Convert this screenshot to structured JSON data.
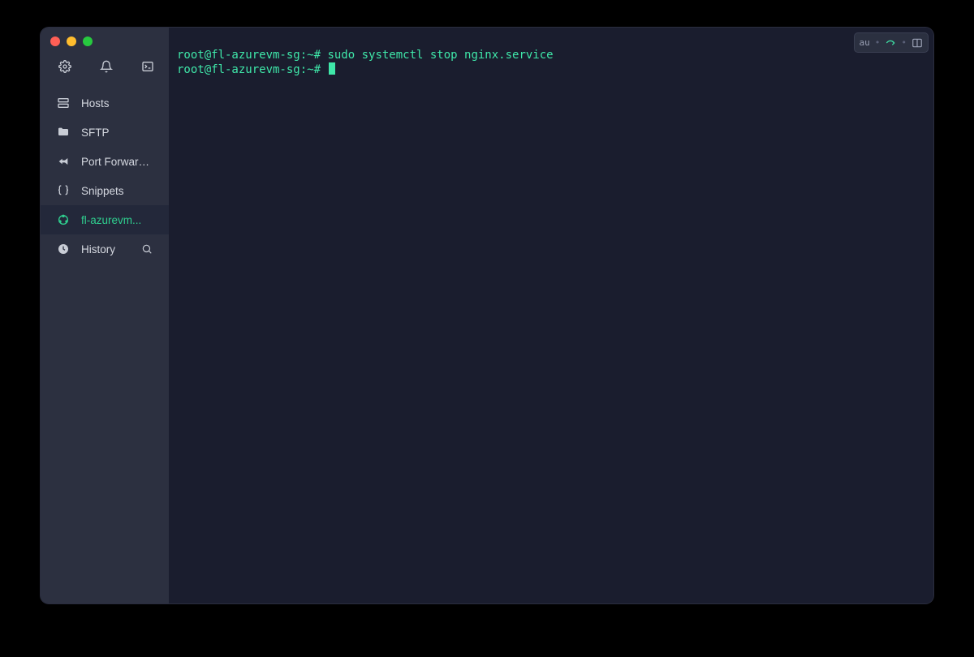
{
  "sidebar": {
    "topIcons": [
      "gear-icon",
      "bell-icon",
      "terminal-icon"
    ],
    "items": [
      {
        "icon": "server-icon",
        "label": "Hosts"
      },
      {
        "icon": "folder-icon",
        "label": "SFTP"
      },
      {
        "icon": "forward-icon",
        "label": "Port Forwarding"
      },
      {
        "icon": "braces-icon",
        "label": "Snippets"
      },
      {
        "icon": "ubuntu-icon",
        "label": "fl-azurevm...",
        "active": true
      },
      {
        "icon": "clock-icon",
        "label": "History",
        "trailing": "search-icon"
      }
    ]
  },
  "terminal": {
    "lines": [
      {
        "prompt": "root@fl-azurevm-sg:~#",
        "cmd": " sudo systemctl stop nginx.service"
      },
      {
        "prompt": "root@fl-azurevm-sg:~#",
        "cmd": " ",
        "cursor": true
      }
    ]
  },
  "toolbar": {
    "label": "au"
  }
}
